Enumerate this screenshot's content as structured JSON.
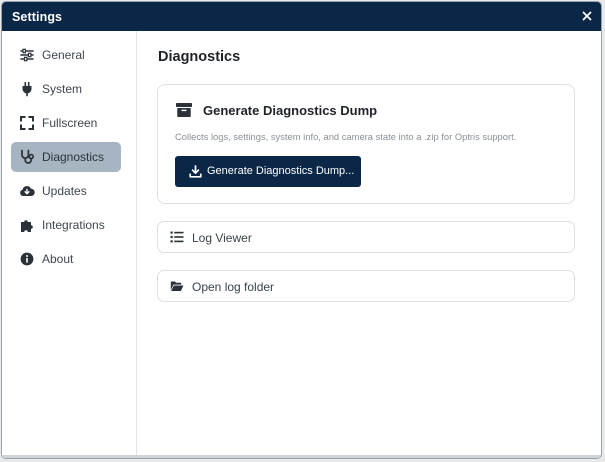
{
  "window": {
    "title": "Settings"
  },
  "sidebar": {
    "items": [
      {
        "label": "General",
        "icon": "sliders-icon",
        "active": false
      },
      {
        "label": "System",
        "icon": "plug-icon",
        "active": false
      },
      {
        "label": "Fullscreen",
        "icon": "expand-icon",
        "active": false
      },
      {
        "label": "Diagnostics",
        "icon": "stethoscope-icon",
        "active": true
      },
      {
        "label": "Updates",
        "icon": "cloud-download-icon",
        "active": false
      },
      {
        "label": "Integrations",
        "icon": "puzzle-icon",
        "active": false
      },
      {
        "label": "About",
        "icon": "info-icon",
        "active": false
      }
    ]
  },
  "main": {
    "title": "Diagnostics",
    "dump_card": {
      "title": "Generate Diagnostics Dump",
      "description": "Collects logs, settings, system info, and camera state into a .zip for Optris support.",
      "button_label": "Generate Diagnostics Dump..."
    },
    "log_viewer_label": "Log Viewer",
    "open_log_folder_label": "Open log folder"
  },
  "colors": {
    "titlebar": "#0a2748",
    "primary_button": "#0a2748",
    "active_nav": "#a7b4c1"
  }
}
